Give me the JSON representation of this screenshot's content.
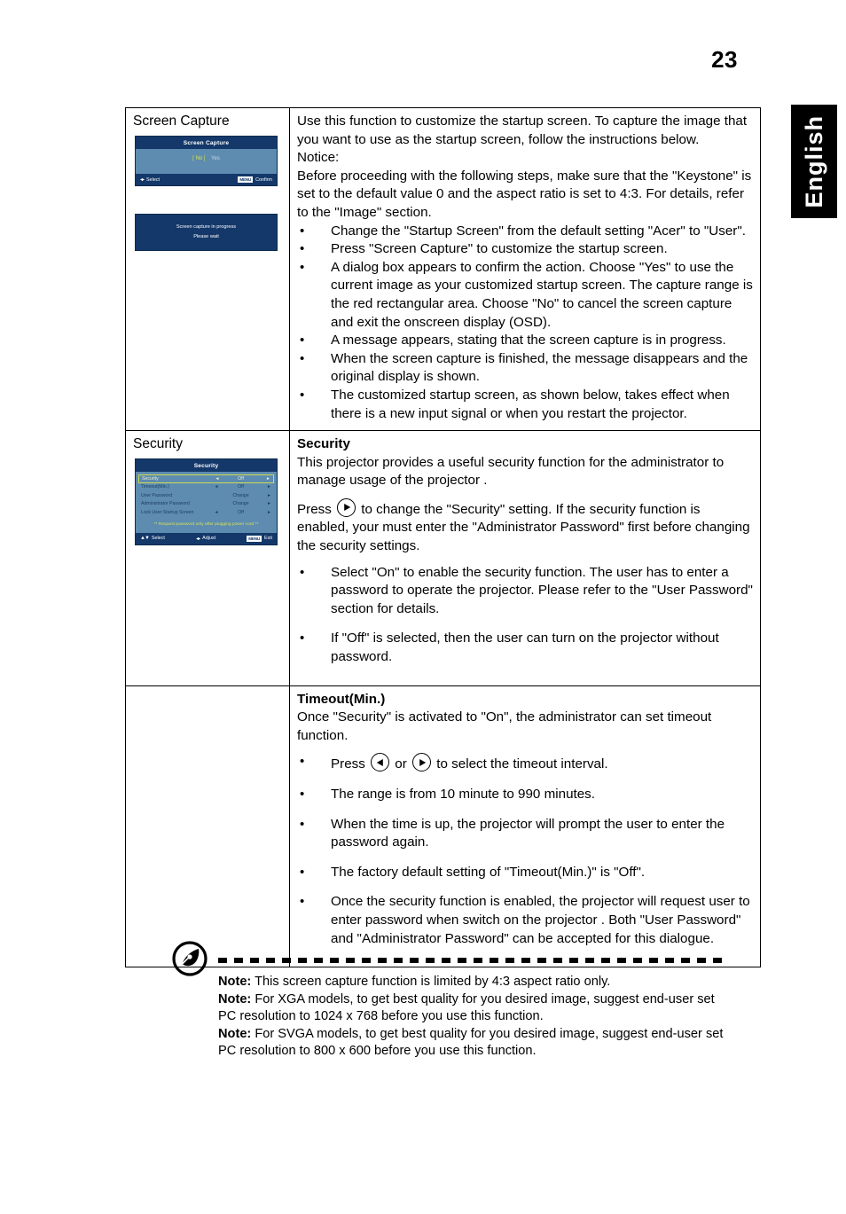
{
  "page": {
    "number": "23",
    "language_tab": "English"
  },
  "table": {
    "rows": [
      {
        "label": "Screen Capture",
        "osd_capture": {
          "title": "Screen Capture",
          "choice_selected": "[  No  ]",
          "choice_other": "Yes",
          "footer_left": "Select",
          "footer_menu_chip": "MENU",
          "footer_right": "Confirm"
        },
        "osd_progress": {
          "line1": "Screen capture in progress",
          "line2": "Please wait"
        },
        "intro": [
          "Use this function to customize the startup screen. To capture the image that you want to use as the startup screen, follow the instructions below.",
          "Notice:",
          "Before proceeding with the following steps, make sure that the \"Keystone\" is set to the default value 0 and the aspect ratio is set to 4:3. For details, refer to the \"Image\" section."
        ],
        "bullets": [
          "Change the \"Startup Screen\" from the default setting \"Acer\" to \"User\".",
          "Press \"Screen Capture\" to customize the startup screen.",
          "A dialog box appears to confirm the action. Choose \"Yes\" to use the current image as your customized startup screen. The capture range is the red rectangular area. Choose \"No\" to cancel the screen capture and exit the onscreen display (OSD).",
          "A message appears, stating that the screen capture is in progress.",
          "When the screen capture is finished, the message disappears and the original display is shown.",
          "The customized startup screen, as shown below, takes effect when there is a new input signal or when you restart the projector."
        ]
      },
      {
        "label": "Security",
        "osd_security": {
          "title": "Security",
          "rows": [
            {
              "name": "Security",
              "left_arrow": "◄",
              "value": "Off",
              "right_arrow": "►",
              "highlighted": true
            },
            {
              "name": "Timeout(Min.)",
              "left_arrow": "◄",
              "value": "Off",
              "right_arrow": "►",
              "highlighted": false
            },
            {
              "name": "User Password",
              "left_arrow": "",
              "value": "Change",
              "right_arrow": "►",
              "highlighted": false
            },
            {
              "name": "Administrator Password",
              "left_arrow": "",
              "value": "Change",
              "right_arrow": "►",
              "highlighted": false
            },
            {
              "name": "Lock User Startup Screen",
              "left_arrow": "◄",
              "value": "Off",
              "right_arrow": "►",
              "highlighted": false
            }
          ],
          "note": "** Request password only after plugging power cord **",
          "footer_select": "Select",
          "footer_adjust": "Adjust",
          "footer_menu_chip": "MENU",
          "footer_exit": "Exit"
        },
        "heading": "Security",
        "paragraph1": "This projector provides a useful security function for the administrator to manage usage of the projector .",
        "paragraph2_before": "Press",
        "paragraph2_after": "to change the \"Security\" setting. If the security function is enabled, your must enter the \"Administrator Password\" first before changing the security settings.",
        "bullets": [
          "Select \"On\" to enable the security function. The user has to enter a password to operate the projector. Please refer to the \"User Password\" section for details.",
          "If \"Off\" is selected, then the user can turn on the projector without password."
        ]
      },
      {
        "label": "",
        "heading": "Timeout(Min.)",
        "paragraph1": "Once \"Security\" is activated to \"On\", the administrator can set timeout function.",
        "bullet_press_before": "Press",
        "bullet_press_or": "or",
        "bullet_press_after": "to select the timeout interval.",
        "bullets": [
          "The range is from 10 minute to 990 minutes.",
          "When the time is up, the projector will prompt the user to enter the password again.",
          "The factory default setting of \"Timeout(Min.)\" is \"Off\".",
          "Once the security function is enabled, the projector will request user to enter password when switch on the projector . Both \"User Password\" and \"Administrator Password\" can be accepted for this dialogue."
        ]
      }
    ]
  },
  "notes": {
    "items": [
      {
        "label": "Note:",
        "text": " This screen capture function is limited by 4:3 aspect ratio only."
      },
      {
        "label": "Note:",
        "text": " For XGA models, to get best quality for you desired image, suggest end-user set PC resolution to 1024 x 768 before you use this function."
      },
      {
        "label": "Note:",
        "text": " For SVGA models, to get best quality for you desired image, suggest end-user set PC resolution to 800 x 600 before you use this function."
      }
    ]
  },
  "colors": {
    "osd_header": "#14386a",
    "osd_body": "#5d8cb0",
    "osd_highlight_border": "#cfd94f",
    "osd_note_text": "#d8e15a",
    "lang_tab_bg": "#000000"
  }
}
